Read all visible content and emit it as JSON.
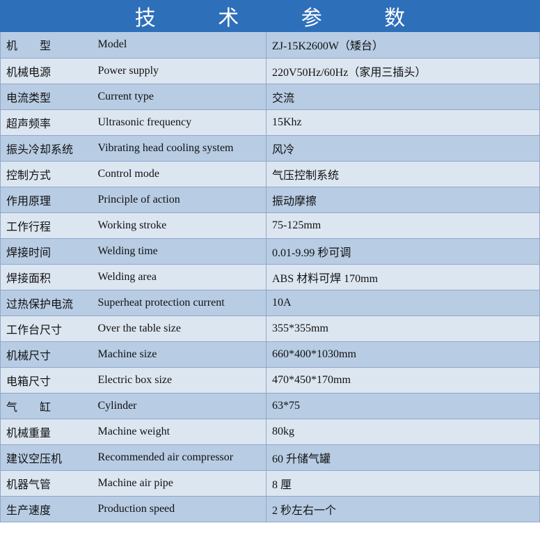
{
  "header": {
    "title": "技 术 参 数"
  },
  "colors": {
    "title_bar": "#2e6fba",
    "row_dark": "#b8cce4",
    "row_light": "#dce6f1"
  },
  "rows": [
    {
      "cn": "机　　型",
      "en": "Model",
      "value": "ZJ-15K2600W（矮台）"
    },
    {
      "cn": "机械电源",
      "en": "Power supply",
      "value": "220V50Hz/60Hz（家用三插头）"
    },
    {
      "cn": "电流类型",
      "en": "Current type",
      "value": "交流"
    },
    {
      "cn": "超声频率",
      "en": "Ultrasonic frequency",
      "value": "15Khz"
    },
    {
      "cn": "振头冷却系统",
      "en": "Vibrating head cooling system",
      "value": "风冷"
    },
    {
      "cn": "控制方式",
      "en": "Control mode",
      "value": "气压控制系统"
    },
    {
      "cn": "作用原理",
      "en": "Principle of action",
      "value": "振动摩擦"
    },
    {
      "cn": "工作行程",
      "en": "Working stroke",
      "value": "75-125mm"
    },
    {
      "cn": "焊接时间",
      "en": "Welding time",
      "value": "0.01-9.99 秒可调"
    },
    {
      "cn": "焊接面积",
      "en": "Welding area",
      "value": "ABS 材料可焊 170mm"
    },
    {
      "cn": "过热保护电流",
      "en": "Superheat protection current",
      "value": "10A"
    },
    {
      "cn": "工作台尺寸",
      "en": "Over the table size",
      "value": "355*355mm"
    },
    {
      "cn": "机械尺寸",
      "en": "Machine size",
      "value": "660*400*1030mm"
    },
    {
      "cn": "电箱尺寸",
      "en": "Electric box size",
      "value": "470*450*170mm"
    },
    {
      "cn": "气　　缸",
      "en": "Cylinder",
      "value": "63*75"
    },
    {
      "cn": "机械重量",
      "en": "Machine weight",
      "value": "80kg"
    },
    {
      "cn": "建议空压机",
      "en": "Recommended air compressor",
      "value": "60 升储气罐"
    },
    {
      "cn": "机器气管",
      "en": "Machine air pipe",
      "value": "8 厘"
    },
    {
      "cn": "生产速度",
      "en": "Production speed",
      "value": "2 秒左右一个"
    }
  ]
}
